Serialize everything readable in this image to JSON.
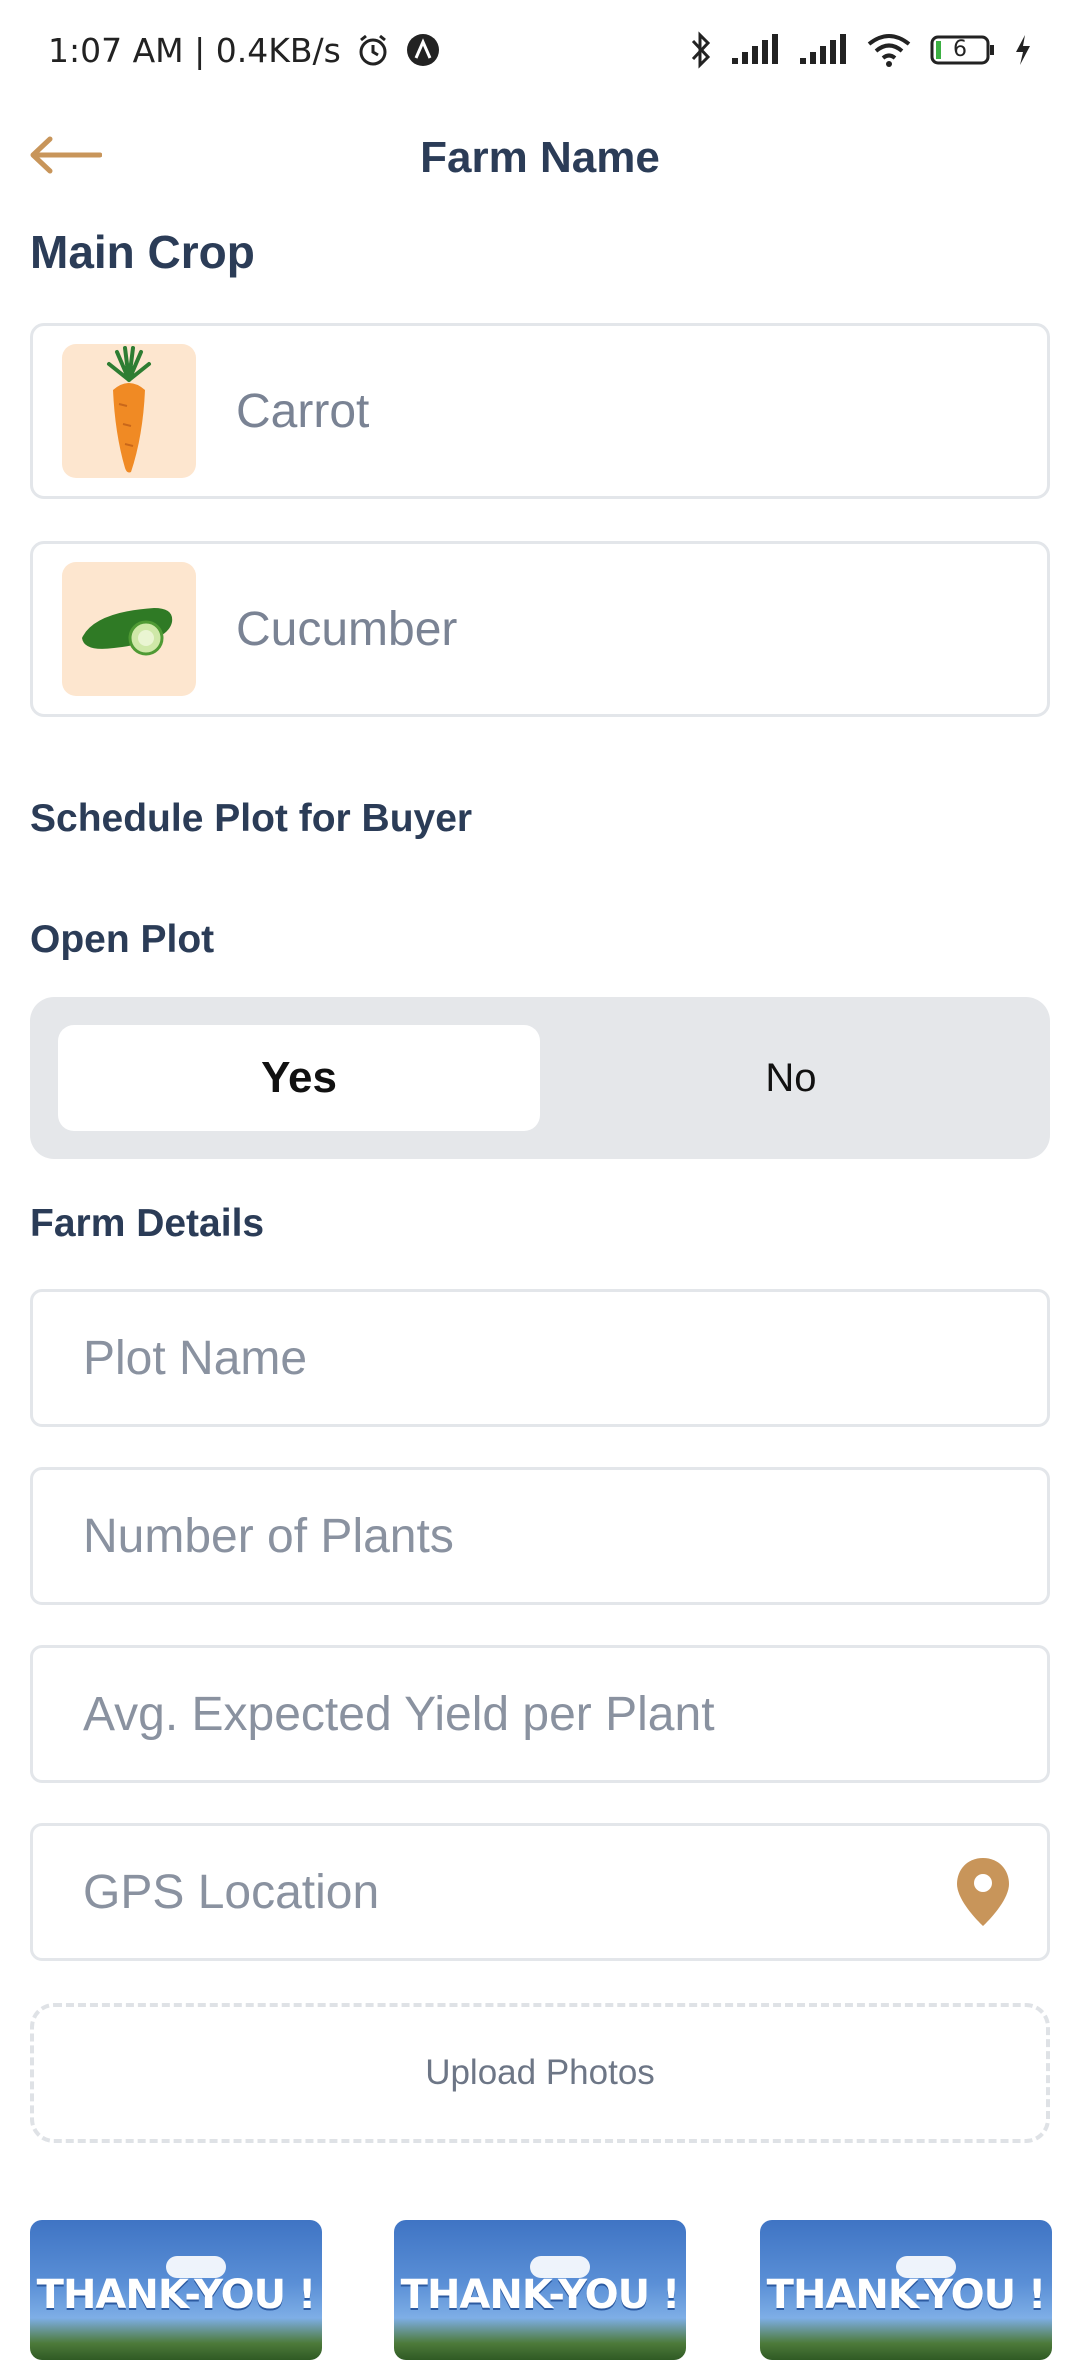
{
  "status_bar": {
    "time_speed": "1:07 AM | 0.4KB/s",
    "battery": "6"
  },
  "header": {
    "title": "Farm Name"
  },
  "main_crop": {
    "title": "Main Crop",
    "crops": [
      {
        "label": "Carrot"
      },
      {
        "label": "Cucumber"
      }
    ]
  },
  "schedule": {
    "title": "Schedule Plot for Buyer"
  },
  "open_plot": {
    "title": "Open Plot",
    "options": [
      "Yes",
      "No"
    ],
    "selected": "Yes"
  },
  "farm_details": {
    "title": "Farm Details",
    "fields": {
      "plot_name": "Plot Name",
      "number_of_plants": "Number of Plants",
      "avg_yield": "Avg. Expected Yield per Plant",
      "gps_location": "GPS Location"
    }
  },
  "upload": {
    "label": "Upload Photos"
  },
  "photos": [
    {
      "text": "THANK-YOU !"
    },
    {
      "text": "THANK-YOU !"
    },
    {
      "text": "THANK-YOU !"
    }
  ],
  "colors": {
    "accent": "#c8955a",
    "title": "#2b3c57",
    "placeholder": "#8a92a0",
    "crop_icon_bg": "#fde6cf"
  }
}
